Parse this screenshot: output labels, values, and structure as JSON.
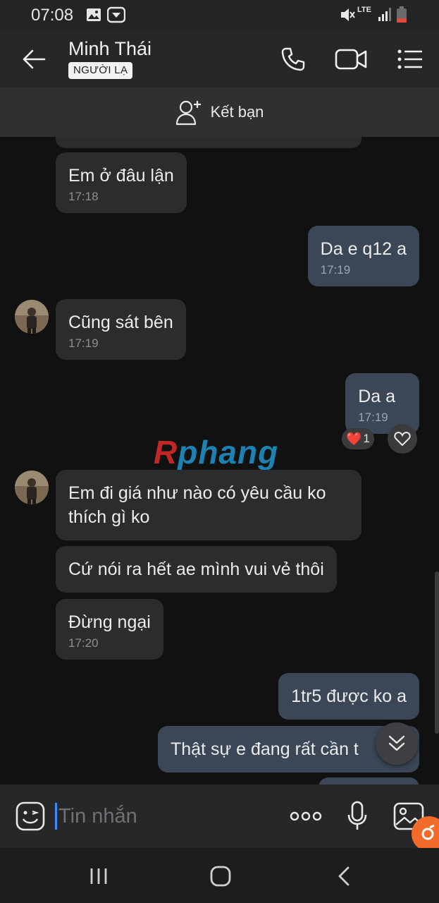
{
  "status_bar": {
    "time": "07:08",
    "network": "LTE",
    "icons": [
      "image-icon",
      "message-app-icon",
      "mute-icon",
      "lte-icon",
      "signal-icon",
      "battery-low-icon"
    ]
  },
  "header": {
    "contact_name": "Minh Thái",
    "badge": "NGƯỜI LẠ",
    "icons": [
      "back-arrow-icon",
      "phone-call-icon",
      "video-call-icon",
      "menu-list-icon"
    ]
  },
  "add_friend": {
    "label": "Kết bạn",
    "icon": "add-person-icon"
  },
  "messages": [
    {
      "direction": "in",
      "text": "Em ở đâu lận",
      "time": "17:18"
    },
    {
      "direction": "out",
      "text": "Da e q12 a",
      "time": "17:19"
    },
    {
      "direction": "in",
      "text": "Cũng sát bên",
      "time": "17:19"
    },
    {
      "direction": "out",
      "text": "Da a",
      "time": "17:19",
      "reaction": {
        "emoji": "❤️",
        "count": "1"
      }
    },
    {
      "direction": "in",
      "text": "Em đi giá như nào có yêu cầu ko thích gì ko",
      "time": ""
    },
    {
      "direction": "in",
      "text": "Cứ nói ra hết ae mình vui vẻ thôi",
      "time": ""
    },
    {
      "direction": "in",
      "text": "Đừng ngại",
      "time": "17:20"
    },
    {
      "direction": "out",
      "text": "1tr5 được ko a",
      "time": ""
    },
    {
      "direction": "out",
      "text": "Thật sự e đang rất cần t",
      "time": ""
    }
  ],
  "watermark": {
    "first": "R",
    "rest": "phang"
  },
  "composer": {
    "placeholder": "Tin nhắn",
    "icons": [
      "emoji-sticker-icon",
      "more-dots-icon",
      "microphone-icon",
      "image-gallery-icon"
    ]
  },
  "colors": {
    "background": "#111111",
    "incoming_bubble": "#2b2c2e",
    "outgoing_bubble": "#3b4656",
    "header": "#252729",
    "accent_caret": "#3d8bff"
  }
}
